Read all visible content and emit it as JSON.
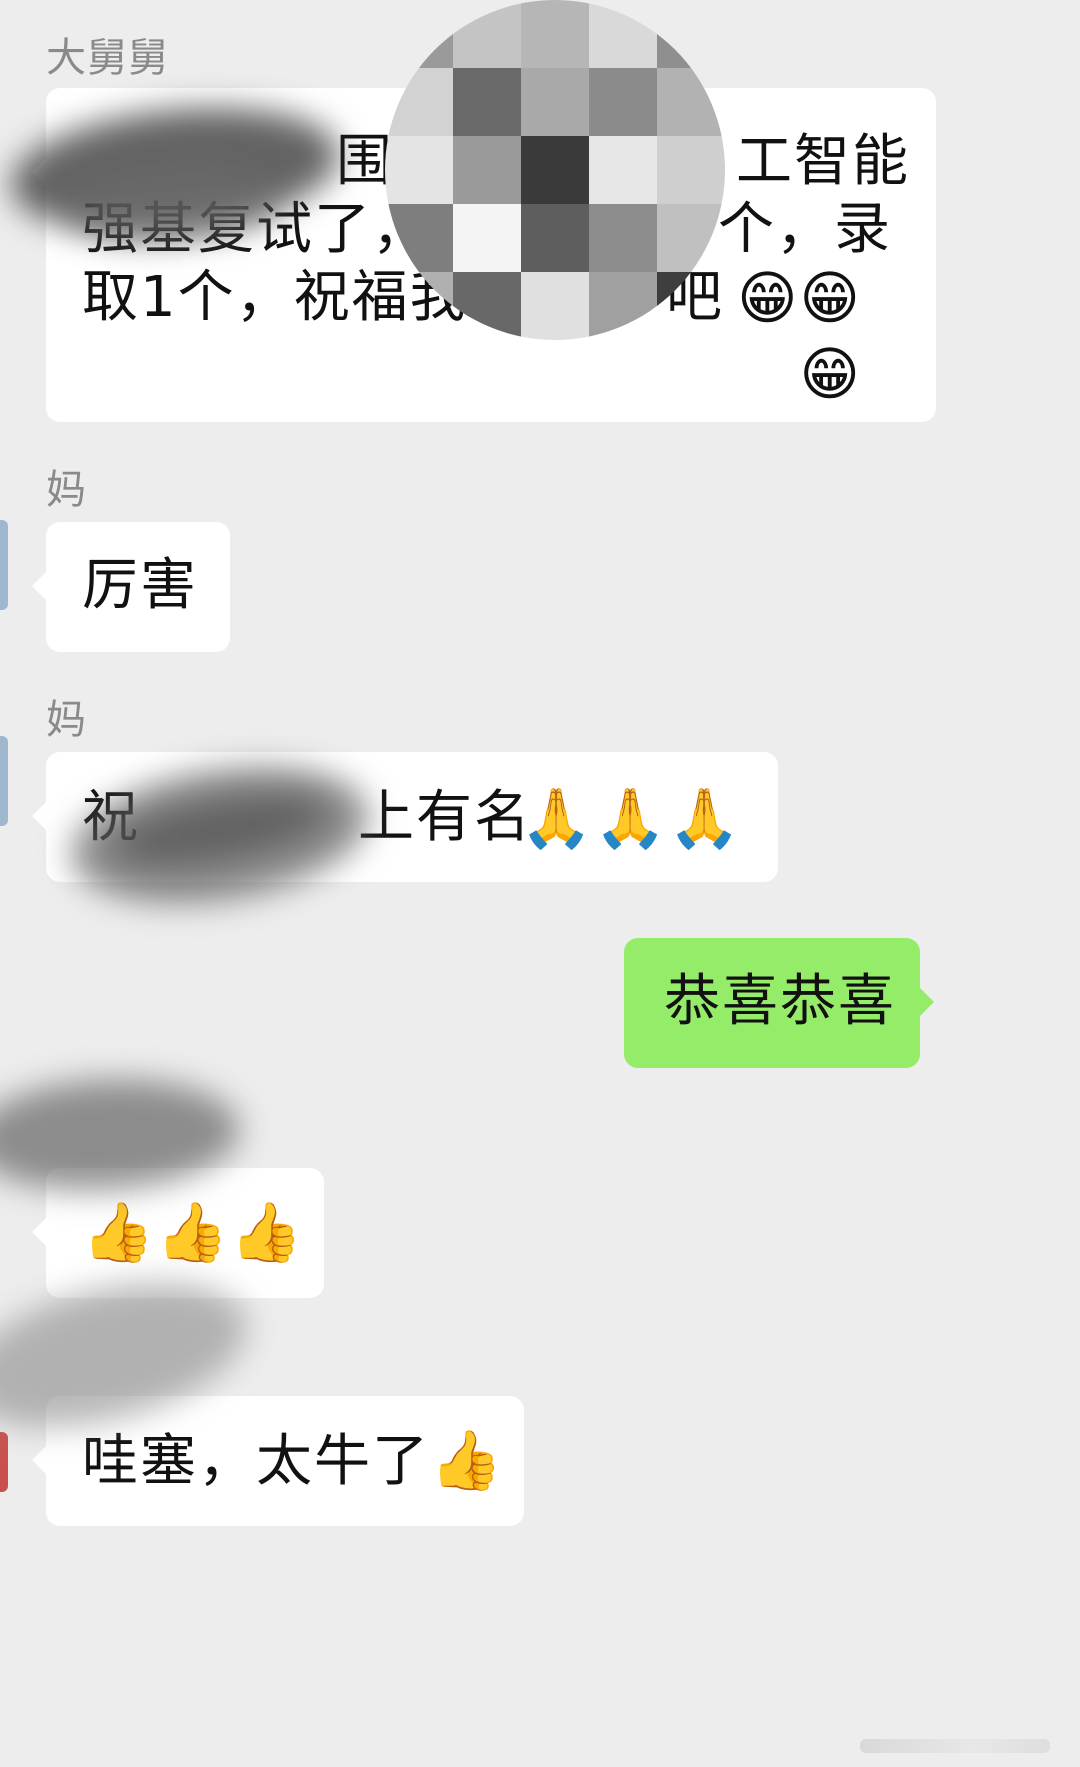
{
  "messages": [
    {
      "sender": "大舅舅",
      "side": "left",
      "visible_text_fragments": [
        "围中",
        "工智能",
        "强基复试了，",
        "个，录",
        "取1个，祝福我",
        "吧"
      ],
      "emoji": "😁😁😁"
    },
    {
      "sender": "妈",
      "side": "left",
      "text": "厉害"
    },
    {
      "sender": "妈",
      "side": "left",
      "visible_text_fragments": [
        "祝",
        "上有名"
      ],
      "emoji": "🙏🙏🙏"
    },
    {
      "sender": "",
      "side": "right",
      "text": "恭喜恭喜"
    },
    {
      "sender": "",
      "side": "left",
      "emoji": "👍👍👍"
    },
    {
      "sender": "",
      "side": "left",
      "text": "哇塞，太牛了",
      "emoji": "👍"
    }
  ],
  "colors": {
    "background": "#ededed",
    "bubble_left": "#ffffff",
    "bubble_right": "#95ec69",
    "sender_name": "#8a8a8a"
  }
}
